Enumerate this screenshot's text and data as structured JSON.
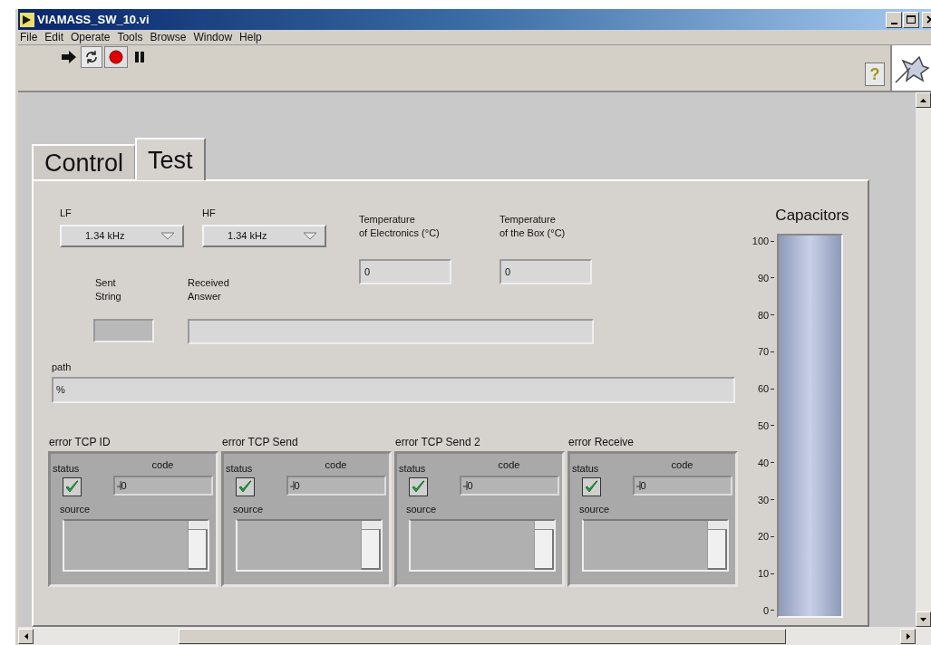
{
  "window": {
    "title": "VIAMASS_SW_10.vi"
  },
  "menu": [
    "File",
    "Edit",
    "Operate",
    "Tools",
    "Browse",
    "Window",
    "Help"
  ],
  "toolbar": [
    {
      "kind": "run"
    },
    {
      "kind": "run_continuous"
    },
    {
      "kind": "abort"
    },
    {
      "kind": "pause"
    }
  ],
  "help_button": {
    "label": "?"
  },
  "tabs": [
    {
      "label": "Control",
      "selected": false
    },
    {
      "label": "Test",
      "selected": true
    }
  ],
  "selectors": [
    {
      "label": "LF",
      "value": "1.34 kHz"
    },
    {
      "label": "HF",
      "value": "1.34 kHz"
    }
  ],
  "temperatures": [
    {
      "label": [
        "Temperature",
        "of Electronics (°C)"
      ],
      "value": "0"
    },
    {
      "label": [
        "Temperature",
        "of the Box (°C)"
      ],
      "value": "0"
    }
  ],
  "sent_string": {
    "label": [
      "Sent",
      "String"
    ]
  },
  "received_answer": {
    "label": [
      "Received",
      "Answer"
    ]
  },
  "path": {
    "label": "path",
    "value": "%"
  },
  "errors": [
    {
      "title": "error TCP ID",
      "status_label": "status",
      "checked": true,
      "code_label": "code",
      "code": "0",
      "source_label": "source"
    },
    {
      "title": "error TCP Send",
      "status_label": "status",
      "checked": true,
      "code_label": "code",
      "code": "0",
      "source_label": "source"
    },
    {
      "title": "error TCP Send 2",
      "status_label": "status",
      "checked": true,
      "code_label": "code",
      "code": "0",
      "source_label": "source"
    },
    {
      "title": "error Receive",
      "status_label": "status",
      "checked": true,
      "code_label": "code",
      "code": "0",
      "source_label": "source"
    }
  ],
  "capacitors": {
    "label": "Capacitors",
    "level": 1,
    "ticks": [
      "100",
      "90",
      "80",
      "70",
      "60",
      "50",
      "40",
      "30",
      "20",
      "10",
      "0"
    ]
  }
}
